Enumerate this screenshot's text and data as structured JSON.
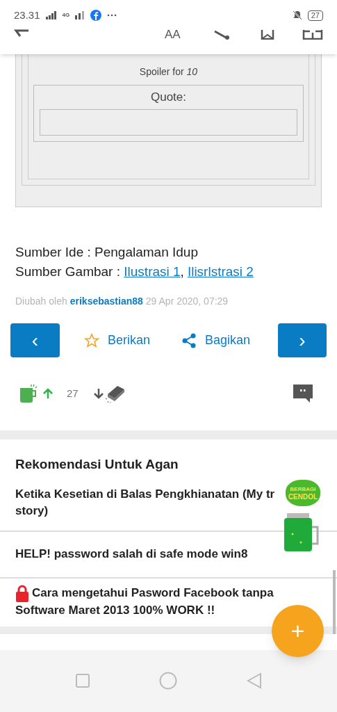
{
  "status_bar": {
    "time": "23.31",
    "network": "4G",
    "battery": "27"
  },
  "toolbar": {
    "font_label": "AA"
  },
  "spoiler": {
    "title": "Spoiler for *10*",
    "quote_label": "Quote:"
  },
  "sources": {
    "idea": "Sumber Ide : Pengalaman Idup",
    "image_label": "Sumber Gambar : ",
    "links": [
      "Ilustrasi 1",
      "Ilisrlstrasi 2"
    ],
    "separator": ","
  },
  "edited": {
    "prefix": "Diubah oleh",
    "user": "eriksebastian88",
    "date": "29 Apr 2020, 07:29"
  },
  "actions": {
    "prev": "‹",
    "give": "Berikan",
    "share": "Bagikan",
    "next": "›"
  },
  "reactions": {
    "count": "27"
  },
  "recommendations": {
    "title": "Rekomendasi Untuk Agan",
    "items": [
      {
        "lines": [
          "Ketika Kesetian di Balas Pengkhianatan (My tr",
          "story)"
        ],
        "locked": false
      },
      {
        "lines": [
          "HELP! password salah di safe mode win8"
        ],
        "locked": false
      },
      {
        "lines": [
          "Cara mengetahui Pasword Facebook tanpa",
          "Software Maret 2013 100% WORK !!"
        ],
        "locked": true
      }
    ]
  },
  "sticker": {
    "lines": [
      "BERBAGI",
      "CENDOL"
    ]
  },
  "fab": "+"
}
